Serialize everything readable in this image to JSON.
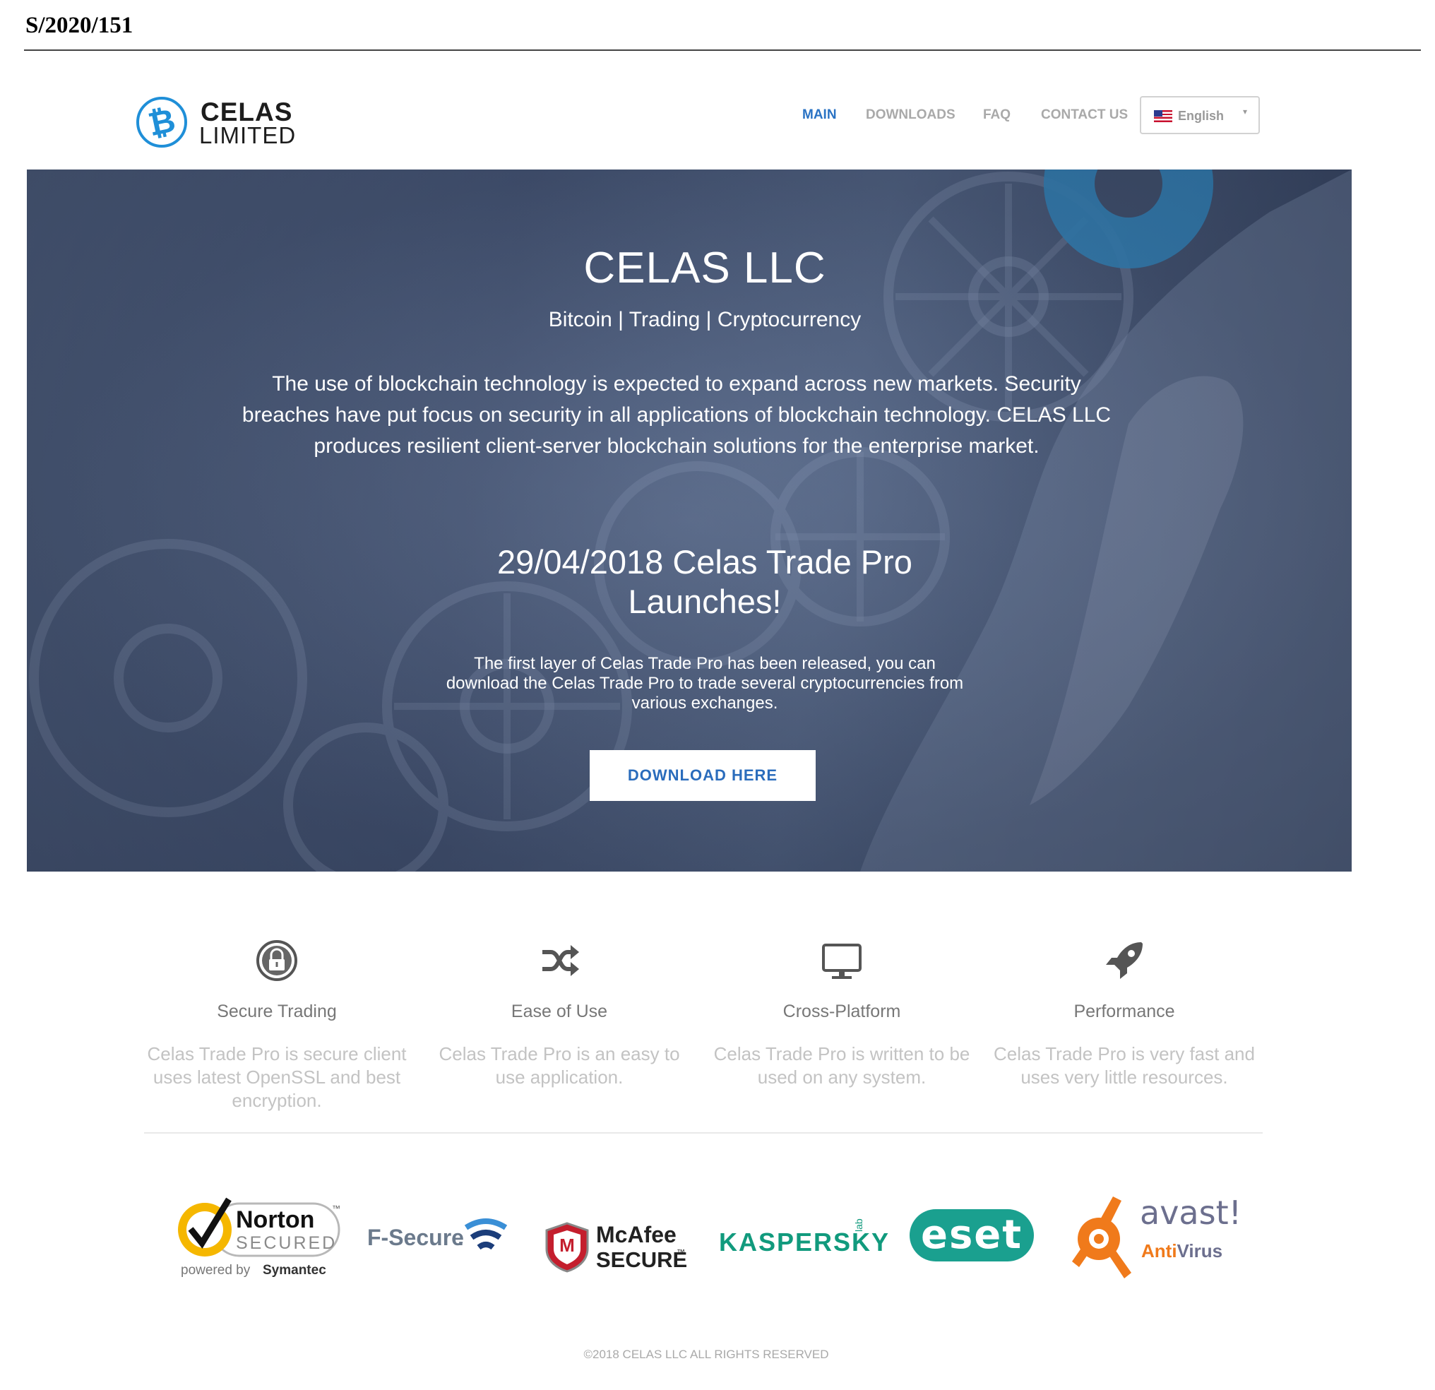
{
  "document": {
    "reference": "S/2020/151"
  },
  "brand": {
    "line1": "CELAS",
    "line2": "LIMITED",
    "logo_color": "#1f8fd8"
  },
  "nav": {
    "items": [
      {
        "label": "MAIN",
        "active": true
      },
      {
        "label": "DOWNLOADS",
        "active": false
      },
      {
        "label": "FAQ",
        "active": false
      },
      {
        "label": "CONTACT US",
        "active": false
      }
    ],
    "language": {
      "label": "English",
      "flag_icon": "us-flag-icon"
    },
    "active_color": "#2a73c4"
  },
  "hero": {
    "title": "CELAS LLC",
    "tagline": "Bitcoin | Trading | Cryptocurrency",
    "intro": "The use of blockchain technology is expected to expand across new markets. Security breaches have put focus on security in all applications of blockchain technology. CELAS LLC produces resilient client-server blockchain solutions for the enterprise market.",
    "launch_title": "29/04/2018 Celas Trade Pro Launches!",
    "launch_text": "The first layer of Celas Trade Pro has been released, you can download the Celas Trade Pro to trade several cryptocurrencies from various exchanges.",
    "button": "DOWNLOAD HERE"
  },
  "features": [
    {
      "icon": "padlock-icon",
      "title": "Secure Trading",
      "text": "Celas Trade Pro is secure client uses latest OpenSSL and best encryption."
    },
    {
      "icon": "shuffle-icon",
      "title": "Ease of Use",
      "text": "Celas Trade Pro is an easy to use application."
    },
    {
      "icon": "monitor-icon",
      "title": "Cross-Platform",
      "text": "Celas Trade Pro is written to be used on any system."
    },
    {
      "icon": "rocket-icon",
      "title": "Performance",
      "text": "Celas Trade Pro is very fast and uses very little resources."
    }
  ],
  "security_logos": {
    "norton": {
      "name": "Norton",
      "sub": "SECURED",
      "powered": "powered by",
      "by": "Symantec",
      "tm": "™"
    },
    "fsecure": {
      "name": "F-Secure",
      "dot": "."
    },
    "mcafee": {
      "name": "McAfee",
      "sub": "SECURE",
      "tm": "™",
      "badge": "M"
    },
    "kaspersky": {
      "name": "KASPERSKY",
      "lab": "lab"
    },
    "eset": {
      "name": "eset"
    },
    "avast": {
      "name": "avast!",
      "anti": "Anti",
      "virus": "Virus"
    }
  },
  "footer": {
    "text": "©2018 CELAS LLC ALL RIGHTS RESERVED"
  }
}
